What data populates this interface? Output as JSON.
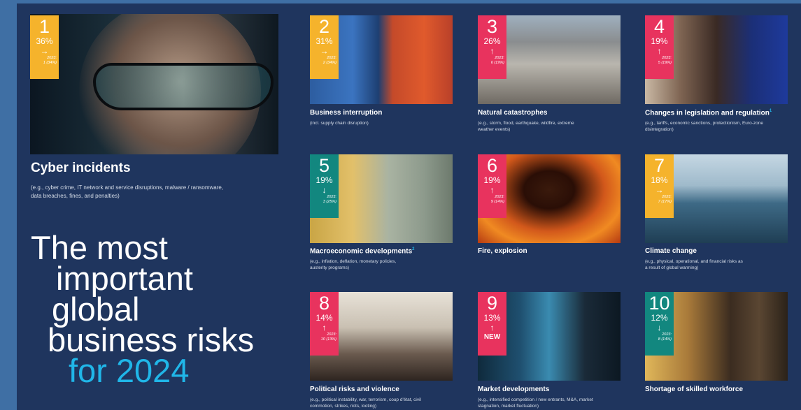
{
  "colors": {
    "page_bg": "#3f6fa4",
    "panel_bg": "#1f355e",
    "accent_blue": "#20b6e8",
    "badge_yellow": "#f5b32c",
    "badge_pink": "#e8335e",
    "badge_teal": "#12877f"
  },
  "hero": {
    "rank": "1",
    "percent": "36%",
    "trend_icon": "arrow-right",
    "trend": "→",
    "year_label": "2023:",
    "previous": "1 (34%)",
    "title": "Cyber incidents",
    "description": "(e.g., cyber crime, IT network and service disruptions, malware / ransomware, data breaches, fines, and penalties)"
  },
  "headline": {
    "line1": "The most",
    "line2": "important",
    "line3": "global",
    "line4": "business risks",
    "line5": "for 2024"
  },
  "risks": [
    {
      "rank": "2",
      "percent": "31%",
      "trend_icon": "arrow-right",
      "trend": "→",
      "year_label": "2023:",
      "previous": "2 (34%)",
      "badge_color": "#f5b32c",
      "title": "Business interruption",
      "description": "(incl. supply chain disruption)"
    },
    {
      "rank": "3",
      "percent": "26%",
      "trend_icon": "arrow-up",
      "trend": "↑",
      "year_label": "2023:",
      "previous": "6 (19%)",
      "badge_color": "#e8335e",
      "title": "Natural catastrophes",
      "description": "(e.g., storm, flood, earthquake, wildfire, extreme weather events)"
    },
    {
      "rank": "4",
      "percent": "19%",
      "trend_icon": "arrow-up",
      "trend": "↑",
      "year_label": "2023:",
      "previous": "5 (19%)",
      "badge_color": "#e8335e",
      "title": "Changes in legislation and regulation",
      "footnote": "1",
      "description": "(e.g., tariffs, economic sanctions, protectionism, Euro-zone disintegration)"
    },
    {
      "rank": "5",
      "percent": "19%",
      "trend_icon": "arrow-down",
      "trend": "↓",
      "year_label": "2023:",
      "previous": "3 (25%)",
      "badge_color": "#12877f",
      "title": "Macroeconomic developments",
      "footnote": "2",
      "description": "(e.g., inflation, deflation, monetary policies, austerity programs)"
    },
    {
      "rank": "6",
      "percent": "19%",
      "trend_icon": "arrow-up",
      "trend": "↑",
      "year_label": "2023:",
      "previous": "9 (14%)",
      "badge_color": "#e8335e",
      "title": "Fire, explosion",
      "description": ""
    },
    {
      "rank": "7",
      "percent": "18%",
      "trend_icon": "arrow-right",
      "trend": "→",
      "year_label": "2023:",
      "previous": "7 (17%)",
      "badge_color": "#f5b32c",
      "title": "Climate change",
      "description": "(e.g., physical, operational, and financial risks as a result of global warming)"
    },
    {
      "rank": "8",
      "percent": "14%",
      "trend_icon": "arrow-up",
      "trend": "↑",
      "year_label": "2023:",
      "previous": "10 (13%)",
      "badge_color": "#e8335e",
      "title": "Political risks and violence",
      "description": "(e.g., political instability, war, terrorism, coup d'état, civil commotion, strikes, riots, looting)"
    },
    {
      "rank": "9",
      "percent": "13%",
      "trend_icon": "arrow-up",
      "trend": "↑",
      "new_label": "NEW",
      "badge_color": "#e8335e",
      "title": "Market developments",
      "description": "(e.g., intensified competition / new entrants, M&A, market stagnation, market fluctuation)"
    },
    {
      "rank": "10",
      "percent": "12%",
      "trend_icon": "arrow-down",
      "trend": "↓",
      "year_label": "2023:",
      "previous": "8 (14%)",
      "badge_color": "#12877f",
      "title": "Shortage of skilled workforce",
      "description": ""
    }
  ]
}
